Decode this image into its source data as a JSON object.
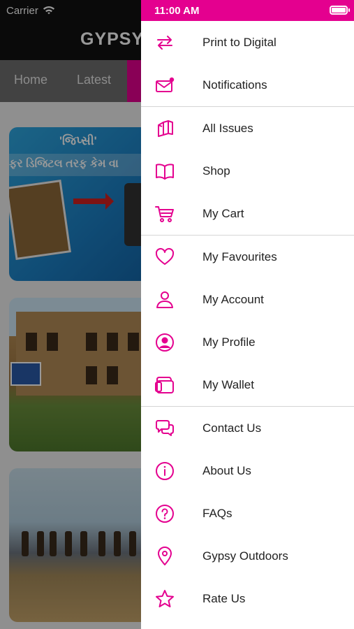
{
  "background": {
    "status_bar": {
      "carrier": "Carrier"
    },
    "header_title": "GYPSY",
    "tabs": [
      "Home",
      "Latest"
    ],
    "card1": {
      "line1": "'જિપ્સી'",
      "line2": "ફર ડિજિટલ તરફ કેમ વા"
    }
  },
  "drawer": {
    "time": "11:00 AM",
    "accent_color": "#e4008f",
    "groups": [
      [
        {
          "label": "Print to Digital",
          "icon": "swap-arrows-icon"
        },
        {
          "label": "Notifications",
          "icon": "mail-notification-icon"
        }
      ],
      [
        {
          "label": "All Issues",
          "icon": "books-stack-icon"
        },
        {
          "label": "Shop",
          "icon": "open-book-icon"
        },
        {
          "label": "My Cart",
          "icon": "cart-icon"
        }
      ],
      [
        {
          "label": "My Favourites",
          "icon": "heart-icon"
        },
        {
          "label": "My Account",
          "icon": "user-icon"
        },
        {
          "label": "My Profile",
          "icon": "user-circle-icon"
        },
        {
          "label": "My Wallet",
          "icon": "wallet-icon"
        }
      ],
      [
        {
          "label": "Contact Us",
          "icon": "chat-bubbles-icon"
        },
        {
          "label": "About Us",
          "icon": "info-circle-icon"
        },
        {
          "label": "FAQs",
          "icon": "question-circle-icon"
        },
        {
          "label": "Gypsy Outdoors",
          "icon": "location-pin-icon"
        },
        {
          "label": "Rate Us",
          "icon": "star-icon"
        }
      ]
    ]
  }
}
